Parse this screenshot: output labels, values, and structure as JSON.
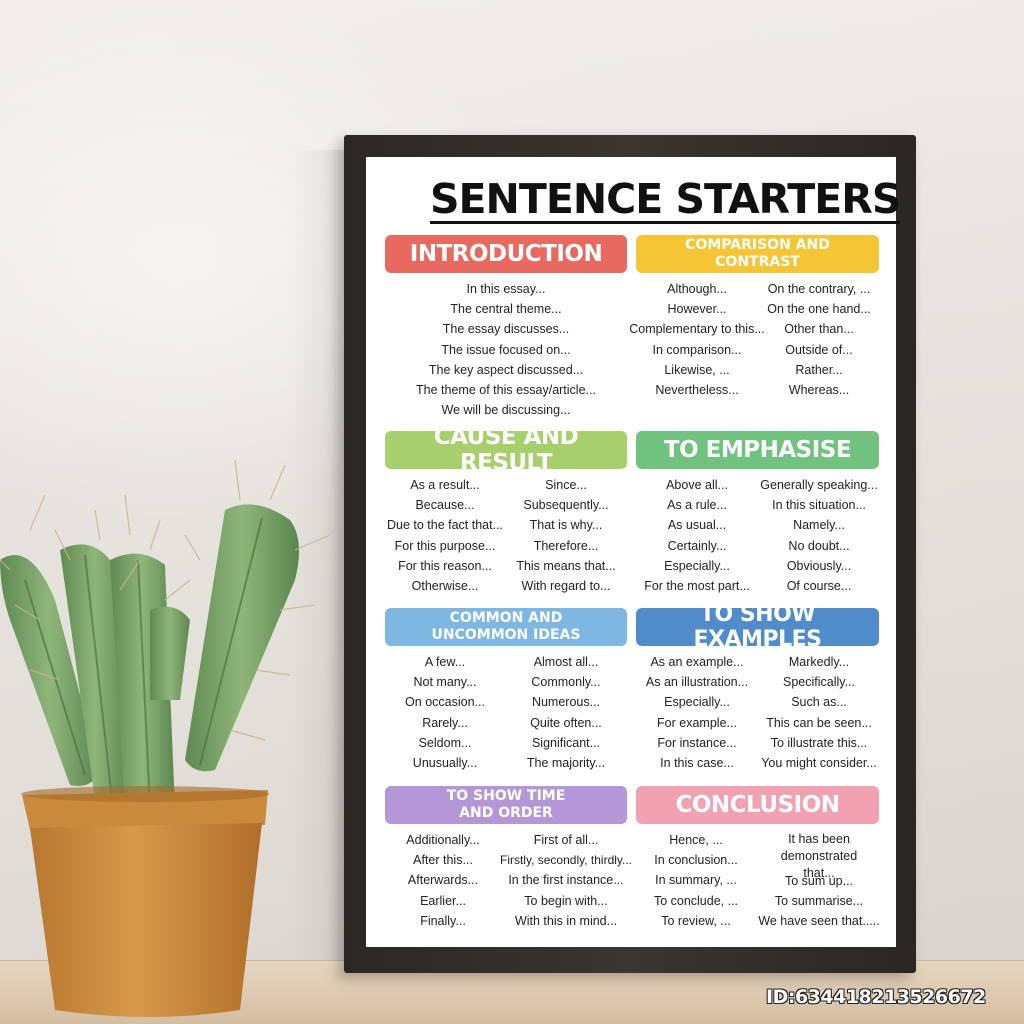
{
  "poster": {
    "title": "SENTENCE STARTERS",
    "sections": [
      {
        "heading": "INTRODUCTION",
        "color": "#e8695f",
        "columns": [
          [
            "In this essay...",
            "The central theme...",
            "The essay discusses...",
            "The issue focused on...",
            "The key aspect discussed...",
            "The theme of this essay/article...",
            "We will be discussing..."
          ]
        ]
      },
      {
        "heading": "COMPARISON AND CONTRAST",
        "color": "#f5c536",
        "columns": [
          [
            "Although...",
            "However...",
            "Complementary to this...",
            "In comparison...",
            "Likewise, ...",
            "Nevertheless..."
          ],
          [
            "On the contrary, ...",
            "On the one hand...",
            "Other than...",
            "Outside of...",
            "Rather...",
            "Whereas..."
          ]
        ]
      },
      {
        "heading": "CAUSE AND RESULT",
        "color": "#a7cf6b",
        "columns": [
          [
            "As a result...",
            "Because...",
            "Due to the fact that...",
            "For this purpose...",
            "For this reason...",
            "Otherwise..."
          ],
          [
            "Since...",
            "Subsequently...",
            "That is why...",
            "Therefore...",
            "This means that...",
            "With regard to..."
          ]
        ]
      },
      {
        "heading": "TO EMPHASISE",
        "color": "#72c27f",
        "columns": [
          [
            "Above all...",
            "As a rule...",
            "As usual...",
            "Certainly...",
            "Especially...",
            "For the most part..."
          ],
          [
            "Generally speaking...",
            "In this situation...",
            "Namely...",
            "No doubt...",
            "Obviously...",
            "Of course..."
          ]
        ]
      },
      {
        "heading": "COMMON AND UNCOMMON IDEAS",
        "color": "#7fb7e3",
        "columns": [
          [
            "A few...",
            "Not many...",
            "On occasion...",
            "Rarely...",
            "Seldom...",
            "Unusually..."
          ],
          [
            "Almost all...",
            "Commonly...",
            "Numerous...",
            "Quite often...",
            "Significant...",
            "The majority..."
          ]
        ]
      },
      {
        "heading": "TO SHOW EXAMPLES",
        "color": "#4f8cc9",
        "columns": [
          [
            "As an example...",
            "As an illustration...",
            "Especially...",
            "For example...",
            "For instance...",
            "In this case..."
          ],
          [
            "Markedly...",
            "Specifically...",
            "Such as...",
            "This can be seen...",
            "To illustrate this...",
            "You might consider..."
          ]
        ]
      },
      {
        "heading": "TO SHOW TIME AND ORDER",
        "color": "#b497d6",
        "columns": [
          [
            "Additionally...",
            "After this...",
            "Afterwards...",
            "Earlier...",
            "Finally..."
          ],
          [
            "First of all...",
            "Firstly, secondly, thirdly...",
            "In the first instance...",
            "To begin with...",
            "With this in mind..."
          ]
        ]
      },
      {
        "heading": "CONCLUSION",
        "color": "#f2a1b2",
        "columns": [
          [
            "Hence, ...",
            "In conclusion...",
            "In summary, ...",
            "To conclude, ...",
            "To review, ..."
          ],
          [
            "It has been demonstrated that...",
            "To sum up...",
            "To summarise...",
            "We have seen that....."
          ]
        ]
      }
    ]
  },
  "watermark": "ID:634418213526672"
}
